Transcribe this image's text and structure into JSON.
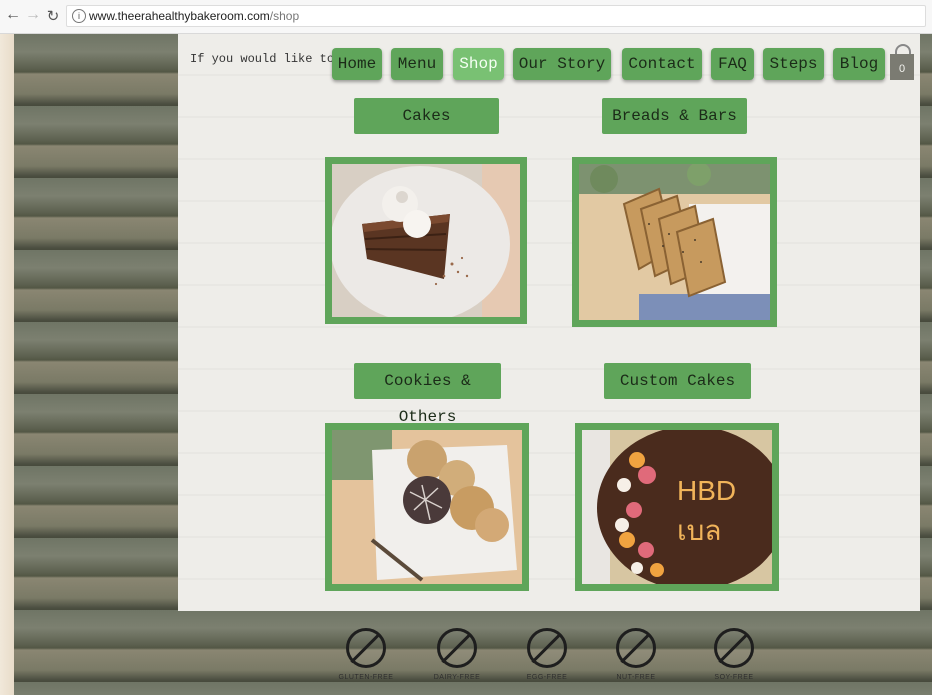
{
  "browser": {
    "url_host": "www.theerahealthybakeroom.com",
    "url_path": "/shop",
    "back_icon": "back-arrow-icon",
    "forward_icon": "forward-arrow-icon",
    "reload_icon": "reload-icon"
  },
  "announcement": "If you would like to",
  "nav": {
    "items": [
      "Home",
      "Menu",
      "Shop",
      "Our Story",
      "Contact",
      "FAQ",
      "Steps",
      "Blog"
    ],
    "active": "Shop",
    "cart_count": "0"
  },
  "categories": [
    {
      "label": "Cakes"
    },
    {
      "label": "Breads & Bars"
    },
    {
      "label": "Cookies & Others"
    },
    {
      "label": "Custom Cakes"
    }
  ],
  "colors": {
    "accent": "#5fa55a",
    "accent_active": "#79c173",
    "panel": "#eeede9"
  },
  "badges": [
    {
      "label": "GLUTEN-FREE",
      "icon": "gluten-free-icon"
    },
    {
      "label": "DAIRY-FREE",
      "icon": "dairy-free-icon"
    },
    {
      "label": "EGG-FREE",
      "icon": "egg-free-icon"
    },
    {
      "label": "NUT-FREE",
      "icon": "nut-free-icon"
    },
    {
      "label": "SOY-FREE",
      "icon": "soy-free-icon"
    }
  ]
}
